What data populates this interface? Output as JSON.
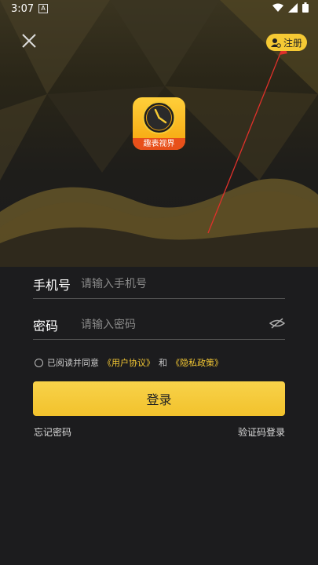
{
  "status": {
    "time": "3:07",
    "a_icon": "A"
  },
  "header": {
    "register_label": "注册"
  },
  "logo": {
    "banner_text": "趣表视界"
  },
  "form": {
    "phone_label": "手机号",
    "phone_placeholder": "请输入手机号",
    "password_label": "密码",
    "password_placeholder": "请输入密码"
  },
  "agreement": {
    "prefix": "已阅读并同意",
    "user_agreement": "《用户协议》",
    "and": "和",
    "privacy_policy": "《隐私政策》"
  },
  "actions": {
    "login_label": "登录",
    "forgot_password": "忘记密码",
    "code_login": "验证码登录"
  },
  "colors": {
    "accent": "#f5c934",
    "background": "#1c1c1e"
  }
}
